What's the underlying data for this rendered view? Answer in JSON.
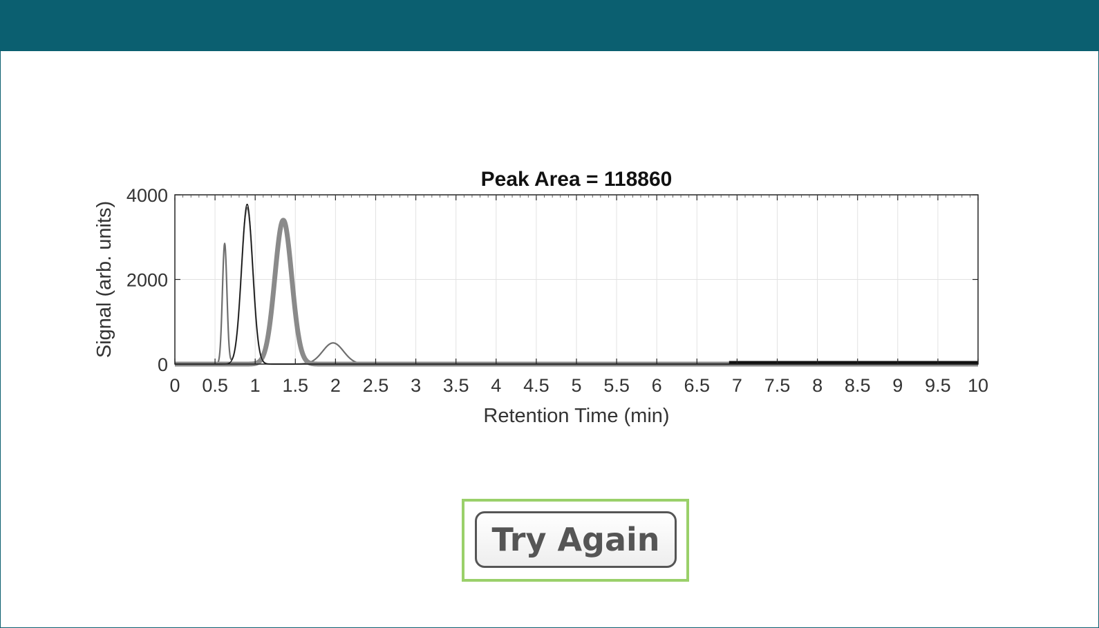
{
  "button": {
    "label": "Try Again"
  },
  "colors": {
    "header": "#0b5f70",
    "focus_outline": "#9ad06a"
  },
  "chart_data": {
    "type": "line",
    "title": "Peak Area = 118860",
    "xlabel": "Retention Time (min)",
    "ylabel": "Signal (arb. units)",
    "xlim": [
      0,
      10
    ],
    "ylim": [
      0,
      4000
    ],
    "x_ticks": [
      "0",
      "0.5",
      "1",
      "1.5",
      "2",
      "2.5",
      "3",
      "3.5",
      "4",
      "4.5",
      "5",
      "5.5",
      "6",
      "6.5",
      "7",
      "7.5",
      "8",
      "8.5",
      "9",
      "9.5",
      "10"
    ],
    "y_ticks": [
      "0",
      "2000",
      "4000"
    ],
    "grid": true,
    "series": [
      {
        "style": "thin-dark-gray",
        "peaks": [
          {
            "center": 0.62,
            "height": 2850,
            "width": 0.028
          },
          {
            "center": 0.9,
            "height": 3700,
            "width": 0.07
          },
          {
            "center": 1.97,
            "height": 500,
            "width": 0.13
          }
        ]
      },
      {
        "style": "thick-gray",
        "peaks": [
          {
            "center": 1.35,
            "height": 3400,
            "width": 0.105
          }
        ]
      },
      {
        "style": "thin-black",
        "peaks": [
          {
            "center": 0.9,
            "height": 3780,
            "width": 0.07
          }
        ]
      }
    ]
  }
}
